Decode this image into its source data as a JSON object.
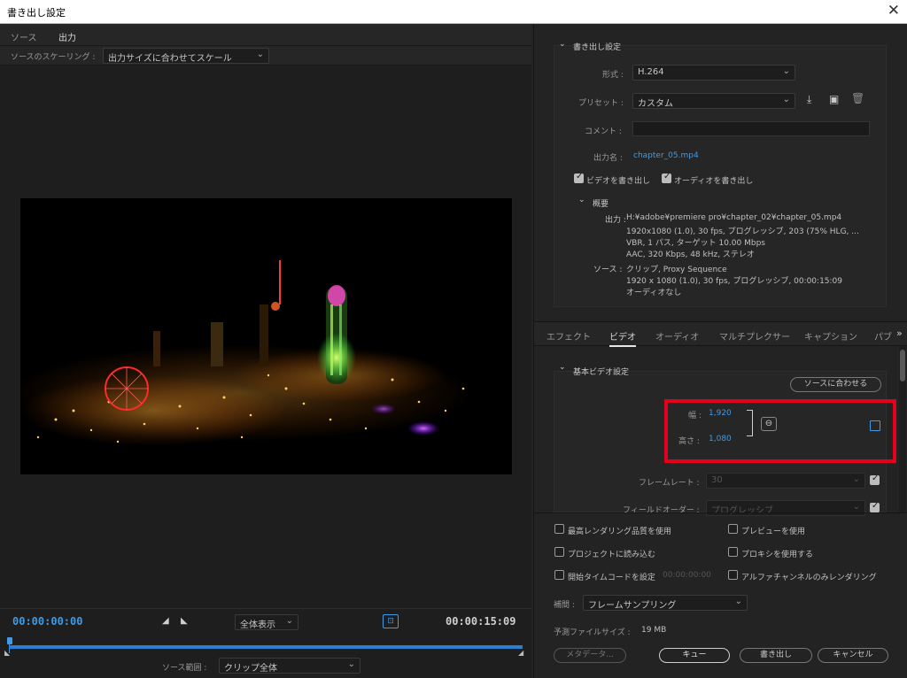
{
  "window": {
    "title": "書き出し設定",
    "close_glyph": "✕"
  },
  "source_tabs": [
    {
      "label": "ソース"
    },
    {
      "label": "出力"
    }
  ],
  "scaling": {
    "label": "ソースのスケーリング :",
    "value": "出力サイズに合わせてスケール"
  },
  "timeline": {
    "current_tc": "00:00:00:00",
    "end_tc": "00:00:15:09",
    "zoom_value": "全体表示",
    "source_range_label": "ソース範囲 :",
    "source_range_value": "クリップ全体"
  },
  "export_settings": {
    "section_title": "書き出し設定",
    "format_label": "形式 :",
    "format_value": "H.264",
    "preset_label": "プリセット :",
    "preset_value": "カスタム",
    "comment_label": "コメント :",
    "comment_value": "",
    "output_name_label": "出力名 :",
    "output_name_value": "chapter_05.mp4",
    "export_video_label": "ビデオを書き出し",
    "export_audio_label": "オーディオを書き出し",
    "export_video_checked": true,
    "export_audio_checked": true
  },
  "summary": {
    "title": "概要",
    "output_label": "出力 :",
    "output_lines": [
      "H:¥adobe¥premiere pro¥chapter_02¥chapter_05.mp4",
      "1920x1080 (1.0), 30 fps, プログレッシブ, 203 (75% HLG, ...",
      "VBR, 1 パス, ターゲット 10.00 Mbps",
      "AAC, 320 Kbps, 48 kHz, ステレオ"
    ],
    "source_label": "ソース :",
    "source_lines": [
      "クリップ, Proxy Sequence",
      "1920 x 1080 (1.0), 30 fps, プログレッシブ, 00:00:15:09",
      "オーディオなし"
    ]
  },
  "settings_tabs": [
    {
      "label": "エフェクト"
    },
    {
      "label": "ビデオ"
    },
    {
      "label": "オーディオ"
    },
    {
      "label": "マルチプレクサー"
    },
    {
      "label": "キャプション"
    },
    {
      "label": "パブ"
    }
  ],
  "settings_tabs_more": "»",
  "basic_video": {
    "title": "基本ビデオ設定",
    "match_source_button": "ソースに合わせる",
    "width_label": "幅 :",
    "width_value": "1,920",
    "height_label": "高さ :",
    "height_value": "1,080",
    "framerate_label": "フレームレート :",
    "framerate_value": "30",
    "field_order_label": "フィールドオーダー :",
    "field_order_value": "プログレッシブ"
  },
  "options": {
    "max_render_quality": "最高レンダリング品質を使用",
    "use_previews": "プレビューを使用",
    "import_into_project": "プロジェクトに読み込む",
    "use_proxies": "プロキシを使用する",
    "set_start_timecode": "開始タイムコードを設定",
    "start_timecode_value": "00:00:00:00",
    "alpha_only": "アルファチャンネルのみレンダリング",
    "interpolation_label": "補間 :",
    "interpolation_value": "フレームサンプリング",
    "file_size_label": "予測ファイルサイズ :",
    "file_size_value": "19 MB"
  },
  "buttons": {
    "metadata": "メタデータ...",
    "queue": "キュー",
    "export": "書き出し",
    "cancel": "キャンセル"
  },
  "colors": {
    "accent": "#3f9ae8",
    "highlight": "#e3001b",
    "timeline_bar": "#2a7fd0"
  }
}
